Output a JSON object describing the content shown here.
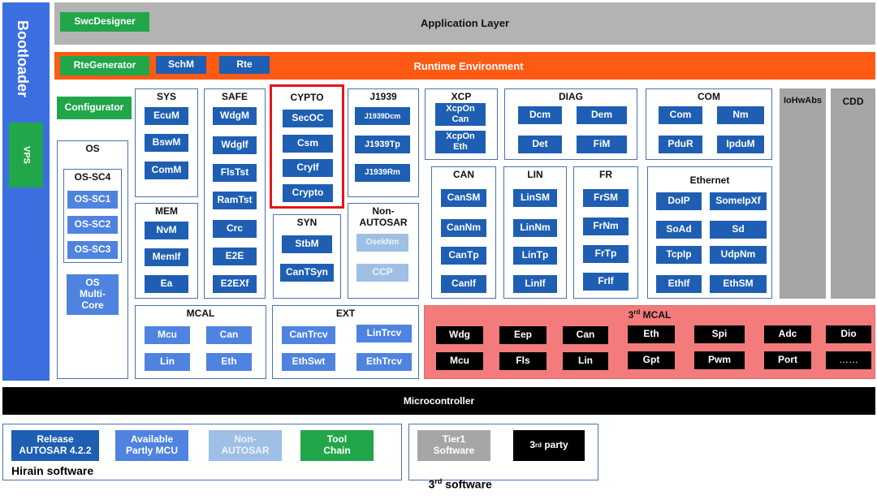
{
  "bootloader": {
    "label": "Bootloader",
    "vps": "VPS"
  },
  "app_layer": {
    "title": "Application Layer",
    "swc": "SwcDesigner"
  },
  "rte_layer": {
    "title": "Runtime Environment",
    "rte_gen": "RteGenerator",
    "schm": "SchM",
    "rte": "Rte"
  },
  "configurator": "Configurator",
  "os": {
    "title": "OS",
    "sc_group": "OS-SC4",
    "sc1": "OS-SC1",
    "sc2": "OS-SC2",
    "sc3": "OS-SC3",
    "multicore": "OS Multi-Core"
  },
  "sys": {
    "title": "SYS",
    "m1": "EcuM",
    "m2": "BswM",
    "m3": "ComM"
  },
  "safe": {
    "title": "SAFE",
    "m1": "WdgM",
    "m2": "WdgIf",
    "m3": "FlsTst",
    "m4": "RamTst",
    "m5": "Crc",
    "m6": "E2E",
    "m7": "E2EXf"
  },
  "cypto": {
    "title": "CYPTO",
    "m1": "SecOC",
    "m2": "Csm",
    "m3": "CryIf",
    "m4": "Crypto"
  },
  "j1939": {
    "title": "J1939",
    "m1": "J1939Dcm",
    "m2": "J1939Tp",
    "m3": "J1939Rm"
  },
  "xcp": {
    "title": "XCP",
    "m1": "XcpOn Can",
    "m2": "XcpOn Eth"
  },
  "diag": {
    "title": "DIAG",
    "m1": "Dcm",
    "m2": "Dem",
    "m3": "Det",
    "m4": "FiM"
  },
  "com": {
    "title": "COM",
    "m1": "Com",
    "m2": "Nm",
    "m3": "PduR",
    "m4": "IpduM"
  },
  "iohwabs": "IoHwAbs",
  "cdd": "CDD",
  "mem": {
    "title": "MEM",
    "m1": "NvM",
    "m2": "MemIf",
    "m3": "Ea"
  },
  "syn": {
    "title": "SYN",
    "m1": "StbM",
    "m2": "CanTSyn"
  },
  "non_autosar": {
    "title": "Non-AUTOSAR",
    "m1": "OsekNm",
    "m2": "CCP"
  },
  "can": {
    "title": "CAN",
    "m1": "CanSM",
    "m2": "CanNm",
    "m3": "CanTp",
    "m4": "CanIf"
  },
  "lin": {
    "title": "LIN",
    "m1": "LinSM",
    "m2": "LinNm",
    "m3": "LinTp",
    "m4": "LinIf"
  },
  "fr": {
    "title": "FR",
    "m1": "FrSM",
    "m2": "FrNm",
    "m3": "FrTp",
    "m4": "FrIf"
  },
  "ethernet": {
    "title": "Ethernet",
    "m1": "DoIP",
    "m2": "SomeIpXf",
    "m3": "SoAd",
    "m4": "Sd",
    "m5": "TcpIp",
    "m6": "UdpNm",
    "m7": "EthIf",
    "m8": "EthSM"
  },
  "mcal": {
    "title": "MCAL",
    "m1": "Mcu",
    "m2": "Can",
    "m3": "Lin",
    "m4": "Eth"
  },
  "ext": {
    "title": "EXT",
    "m1": "CanTrcv",
    "m2": "LinTrcv",
    "m3": "EthSwt",
    "m4": "EthTrcv"
  },
  "mcal3": {
    "title_sup": "rd",
    "title_pre": "3",
    "title_post": " MCAL",
    "row1": [
      "Wdg",
      "Eep",
      "Can",
      "Eth",
      "Spi",
      "Adc",
      "Dio"
    ],
    "row2": [
      "Mcu",
      "Fls",
      "Lin",
      "Gpt",
      "Pwm",
      "Port",
      "……"
    ]
  },
  "microcontroller": "Microcontroller",
  "legend": {
    "release": "Release AUTOSAR  4.2.2",
    "partly": "Available Partly MCU",
    "non_autosar": "Non-AUTOSAR",
    "toolchain": "Tool Chain",
    "hirain": "Hirain software",
    "tier1": "Tier1 Software",
    "third_pre": "3",
    "third_sup": "rd",
    "third_post": " party",
    "third_sw_pre": "3",
    "third_sw_sup": "rd",
    "third_sw_post": " software"
  },
  "colors": {
    "blue": "#1f5fb3",
    "light_blue": "#4f83e0",
    "pale_blue": "#9fbfe6",
    "green": "#22a64a",
    "orange": "#ff5a14",
    "grey": "#a6a6a6",
    "pink": "#f47b7b",
    "black": "#000000",
    "highlight_red": "#e8141c"
  }
}
